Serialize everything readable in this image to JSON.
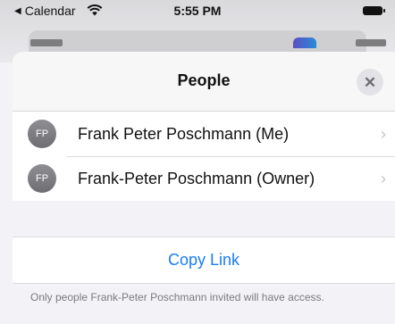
{
  "status_bar": {
    "back_label": "Calendar",
    "time": "5:55 PM"
  },
  "sheet": {
    "title": "People",
    "people": [
      {
        "initials": "FP",
        "name": "Frank Peter Poschmann (Me)"
      },
      {
        "initials": "FP",
        "name": "Frank-Peter Poschmann (Owner)"
      }
    ],
    "copy_link_label": "Copy Link",
    "access_note": "Only people Frank-Peter Poschmann invited will have access."
  },
  "colors": {
    "accent": "#1b7cf4",
    "avatar_bg": "#7a7a7f",
    "sheet_bg": "#f2f2f7"
  },
  "icons": [
    "back-arrow-icon",
    "wifi-icon",
    "battery-icon",
    "close-icon",
    "chevron-right-icon"
  ]
}
